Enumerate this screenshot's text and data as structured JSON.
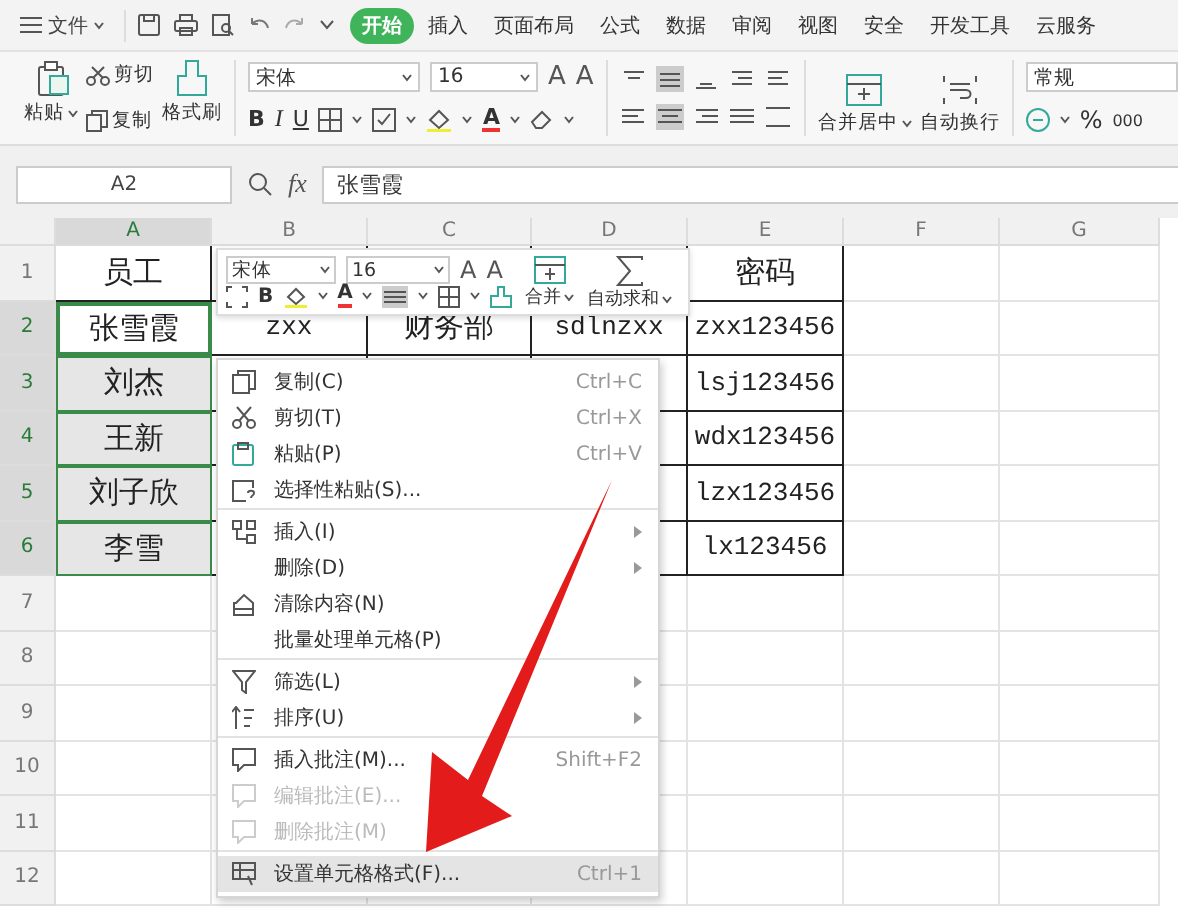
{
  "menubar": {
    "app_menu": "文件",
    "tabs": [
      {
        "label": "开始",
        "selected": true
      },
      {
        "label": "插入",
        "selected": false
      },
      {
        "label": "页面布局",
        "selected": false
      },
      {
        "label": "公式",
        "selected": false
      },
      {
        "label": "数据",
        "selected": false
      },
      {
        "label": "审阅",
        "selected": false
      },
      {
        "label": "视图",
        "selected": false
      },
      {
        "label": "安全",
        "selected": false
      },
      {
        "label": "开发工具",
        "selected": false
      },
      {
        "label": "云服务",
        "selected": false
      }
    ]
  },
  "ribbon": {
    "paste": "粘贴",
    "cut": "剪切",
    "copy": "复制",
    "format_painter": "格式刷",
    "font": "宋体",
    "font_size": "16",
    "font_grow": "A",
    "font_shrink": "A",
    "bold": "B",
    "italic": "I",
    "underline": "U",
    "font_color": "A",
    "merge_center": "合并居中",
    "wrap_text": "自动换行",
    "number_format": "常规",
    "percent": "%",
    "thousands": "000"
  },
  "formula_bar": {
    "cell_ref": "A2",
    "fx": "fx",
    "value": "张雪霞"
  },
  "sheet": {
    "columns": [
      {
        "label": "A",
        "selected": true
      },
      {
        "label": "B",
        "selected": false
      },
      {
        "label": "C",
        "selected": false
      },
      {
        "label": "D",
        "selected": false
      },
      {
        "label": "E",
        "selected": false
      },
      {
        "label": "F",
        "selected": false
      },
      {
        "label": "G",
        "selected": false
      }
    ],
    "rows": [
      {
        "number": "1",
        "selected": false,
        "active": false,
        "cells": {
          "A": "员工",
          "E": "密码"
        }
      },
      {
        "number": "2",
        "selected": true,
        "active": true,
        "cells": {
          "A": "张雪霞",
          "B": "zxx",
          "C": "财务部",
          "D": "sdlnzxx",
          "E": "zxx123456"
        }
      },
      {
        "number": "3",
        "selected": true,
        "active": false,
        "cells": {
          "A": "刘杰",
          "E": "lsj123456"
        }
      },
      {
        "number": "4",
        "selected": true,
        "active": false,
        "cells": {
          "A": "王新",
          "E": "wdx123456"
        }
      },
      {
        "number": "5",
        "selected": true,
        "active": false,
        "cells": {
          "A": "刘子欣",
          "E": "lzx123456"
        }
      },
      {
        "number": "6",
        "selected": true,
        "active": false,
        "cells": {
          "A": "李雪",
          "E": "lx123456"
        }
      },
      {
        "number": "7",
        "selected": false,
        "active": false,
        "cells": {}
      },
      {
        "number": "8",
        "selected": false,
        "active": false,
        "cells": {}
      },
      {
        "number": "9",
        "selected": false,
        "active": false,
        "cells": {}
      },
      {
        "number": "10",
        "selected": false,
        "active": false,
        "cells": {}
      },
      {
        "number": "11",
        "selected": false,
        "active": false,
        "cells": {}
      },
      {
        "number": "12",
        "selected": false,
        "active": false,
        "cells": {}
      }
    ]
  },
  "mini_toolbar": {
    "font": "宋体",
    "font_size": "16",
    "font_grow": "A",
    "font_shrink": "A",
    "bold": "B",
    "font_color": "A",
    "merge": "合并",
    "autosum": "自动求和"
  },
  "context_menu": {
    "items": [
      {
        "label": "复制(C)",
        "shortcut": "Ctrl+C",
        "submenu": false,
        "disabled": false,
        "selected": false
      },
      {
        "label": "剪切(T)",
        "shortcut": "Ctrl+X",
        "submenu": false,
        "disabled": false,
        "selected": false
      },
      {
        "label": "粘贴(P)",
        "shortcut": "Ctrl+V",
        "submenu": false,
        "disabled": false,
        "selected": false
      },
      {
        "label": "选择性粘贴(S)...",
        "submenu": false,
        "disabled": false,
        "selected": false,
        "separator_after": true
      },
      {
        "label": "插入(I)",
        "submenu": true,
        "disabled": false,
        "selected": false
      },
      {
        "label": "删除(D)",
        "submenu": true,
        "disabled": false,
        "selected": false
      },
      {
        "label": "清除内容(N)",
        "submenu": false,
        "disabled": false,
        "selected": false
      },
      {
        "label": "批量处理单元格(P)",
        "submenu": false,
        "disabled": false,
        "selected": false,
        "separator_after": true
      },
      {
        "label": "筛选(L)",
        "submenu": true,
        "disabled": false,
        "selected": false
      },
      {
        "label": "排序(U)",
        "submenu": true,
        "disabled": false,
        "selected": false,
        "separator_after": true
      },
      {
        "label": "插入批注(M)...",
        "shortcut": "Shift+F2",
        "submenu": false,
        "disabled": false,
        "selected": false
      },
      {
        "label": "编辑批注(E)...",
        "submenu": false,
        "disabled": true,
        "selected": false
      },
      {
        "label": "删除批注(M)",
        "submenu": false,
        "disabled": true,
        "selected": false,
        "separator_after": true
      },
      {
        "label": "设置单元格格式(F)...",
        "shortcut": "Ctrl+1",
        "submenu": false,
        "disabled": false,
        "selected": true
      }
    ]
  }
}
